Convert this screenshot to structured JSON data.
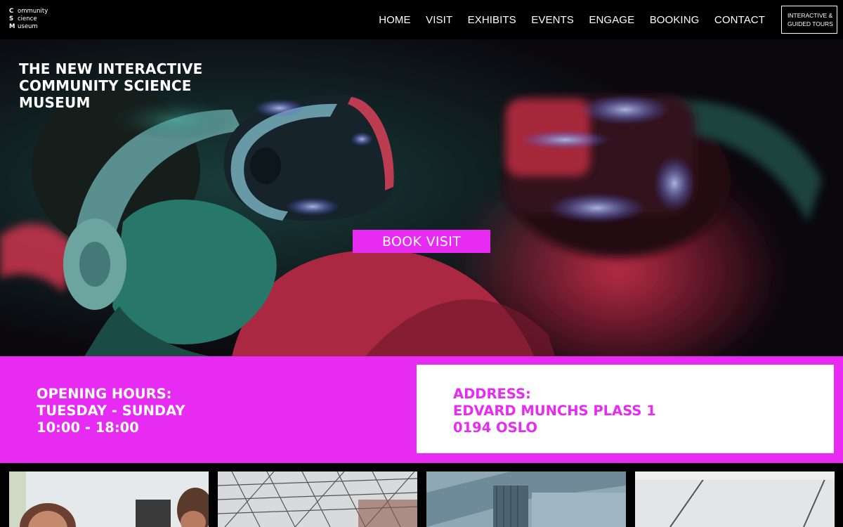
{
  "logo": {
    "rows": [
      {
        "cap": "C",
        "rest": "ommunity"
      },
      {
        "cap": "S",
        "rest": "cience"
      },
      {
        "cap": "M",
        "rest": "useum"
      }
    ]
  },
  "nav": {
    "items": [
      "HOME",
      "VISIT",
      "EXHIBITS",
      "EVENTS",
      "ENGAGE",
      "BOOKING",
      "CONTACT"
    ],
    "tours_button": {
      "line1": "INTERACTIVE &",
      "line2": "GUIDED TOURS"
    }
  },
  "hero": {
    "title_lines": [
      "THE NEW INTERACTIVE",
      "COMMUNITY SCIENCE",
      "MUSEUM"
    ],
    "book_button": "BOOK VISIT"
  },
  "info": {
    "hours_lines": [
      "OPENING HOURS:",
      "TUESDAY - SUNDAY",
      "10:00 - 18:00"
    ],
    "address_lines": [
      "ADDRESS:",
      "EDVARD MUNCHS PLASS 1",
      "0194 OSLO"
    ]
  },
  "colors": {
    "accent": "#e82bf2",
    "background": "#000000",
    "text_light": "#ffffff"
  }
}
